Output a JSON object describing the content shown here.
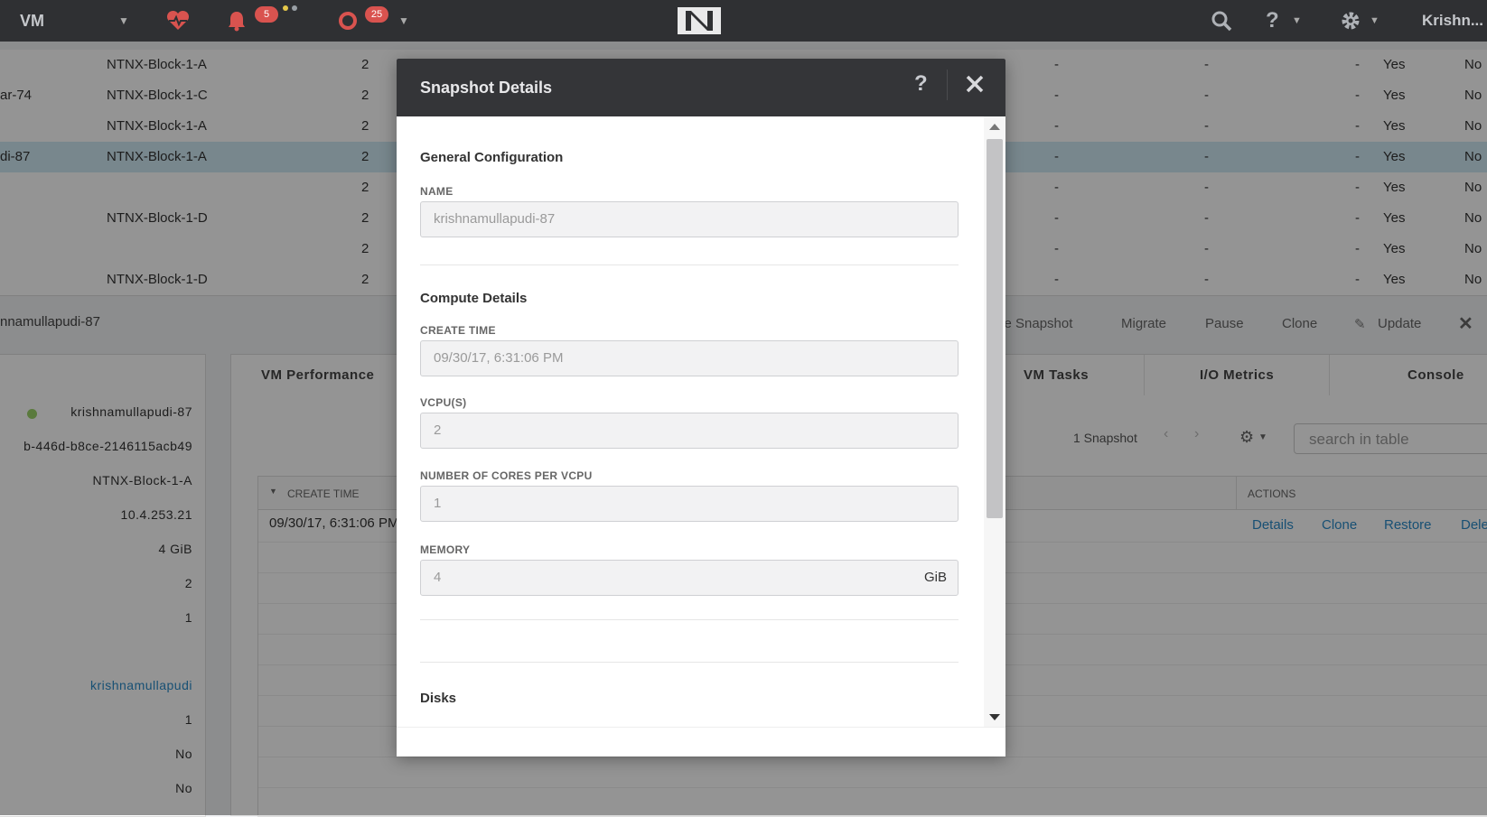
{
  "topbar": {
    "section": "VM",
    "alerts_count": "5",
    "tasks_count": "25",
    "user": "Krishn..."
  },
  "bg_table": {
    "rows": [
      {
        "name": "",
        "block": "NTNX-Block-1-A",
        "cores": "2",
        "d1": "-",
        "d2": "-",
        "d3": "-",
        "yes": "Yes",
        "no": "No"
      },
      {
        "name": "ar-74",
        "block": "NTNX-Block-1-C",
        "cores": "2",
        "d1": "-",
        "d2": "-",
        "d3": "-",
        "yes": "Yes",
        "no": "No"
      },
      {
        "name": "",
        "block": "NTNX-Block-1-A",
        "cores": "2",
        "d1": "-",
        "d2": "-",
        "d3": "-",
        "yes": "Yes",
        "no": "No"
      },
      {
        "name": "di-87",
        "block": "NTNX-Block-1-A",
        "cores": "2",
        "d1": "-",
        "d2": "-",
        "d3": "-",
        "yes": "Yes",
        "no": "No"
      },
      {
        "name": "",
        "block": "",
        "cores": "2",
        "d1": "-",
        "d2": "-",
        "d3": "-",
        "yes": "Yes",
        "no": "No"
      },
      {
        "name": "",
        "block": "NTNX-Block-1-D",
        "cores": "2",
        "d1": "-",
        "d2": "-",
        "d3": "-",
        "yes": "Yes",
        "no": "No"
      },
      {
        "name": "",
        "block": "",
        "cores": "2",
        "d1": "-",
        "d2": "-",
        "d3": "-",
        "yes": "Yes",
        "no": "No"
      },
      {
        "name": "",
        "block": "NTNX-Block-1-D",
        "cores": "2",
        "d1": "-",
        "d2": "-",
        "d3": "-",
        "yes": "Yes",
        "no": "No"
      }
    ]
  },
  "detail": {
    "vm_name": "nnamullapudi-87",
    "actions": {
      "take_snapshot": "ke Snapshot",
      "migrate": "Migrate",
      "pause": "Pause",
      "clone": "Clone",
      "update": "Update"
    },
    "left_values": {
      "name": "krishnamullapudi-87",
      "uuid": "b-446d-b8ce-2146115acb49",
      "host": "NTNX-Block-1-A",
      "ip": "10.4.253.21",
      "memory": "4 GiB",
      "vcpus": "2",
      "cores": "1",
      "owner": "krishnamullapudi",
      "v1": "1",
      "v2": "No",
      "v3": "No"
    },
    "tabs": [
      "VM Performance",
      "VM Tasks",
      "I/O Metrics",
      "Console"
    ],
    "snap_count": "1 Snapshot",
    "search_placeholder": "search in table",
    "table": {
      "col_create_time": "CREATE TIME",
      "col_actions": "ACTIONS",
      "row_create_time": "09/30/17, 6:31:06 PM",
      "links": {
        "details": "Details",
        "clone": "Clone",
        "restore": "Restore",
        "delete": "Dele"
      }
    }
  },
  "modal": {
    "title": "Snapshot Details",
    "help": "?",
    "general_title": "General Configuration",
    "name_label": "NAME",
    "name_value": "krishnamullapudi-87",
    "compute_title": "Compute Details",
    "create_time_label": "CREATE TIME",
    "create_time_value": "09/30/17, 6:31:06 PM",
    "vcpus_label": "VCPU(S)",
    "vcpus_value": "2",
    "cores_label": "NUMBER OF CORES PER VCPU",
    "cores_value": "1",
    "memory_label": "MEMORY",
    "memory_value": "4",
    "memory_unit": "GiB",
    "disks_title": "Disks"
  },
  "colors": {
    "topbar_bg": "#2f3033",
    "modal_header_bg": "#343538",
    "badge_red": "#d9534f",
    "link_blue": "#2a8ac8",
    "selected_row": "#cfe8f3"
  }
}
